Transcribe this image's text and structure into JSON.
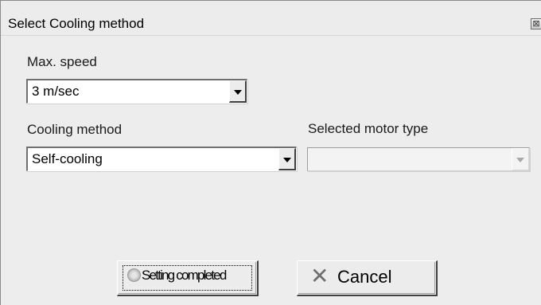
{
  "window": {
    "title": "Select Cooling method",
    "close_icon": "close-icon",
    "close_glyph": "⊠"
  },
  "max_speed": {
    "label": "Max. speed",
    "value": "3 m/sec"
  },
  "cooling_method": {
    "label": "Cooling method",
    "value": "Self-cooling"
  },
  "motor_type": {
    "label": "Selected motor type",
    "value": "",
    "disabled": true
  },
  "buttons": {
    "setting_completed": {
      "label": "Setting completed",
      "icon": "circle-icon"
    },
    "cancel": {
      "label": "Cancel",
      "icon": "x-icon",
      "glyph": "✕"
    }
  }
}
